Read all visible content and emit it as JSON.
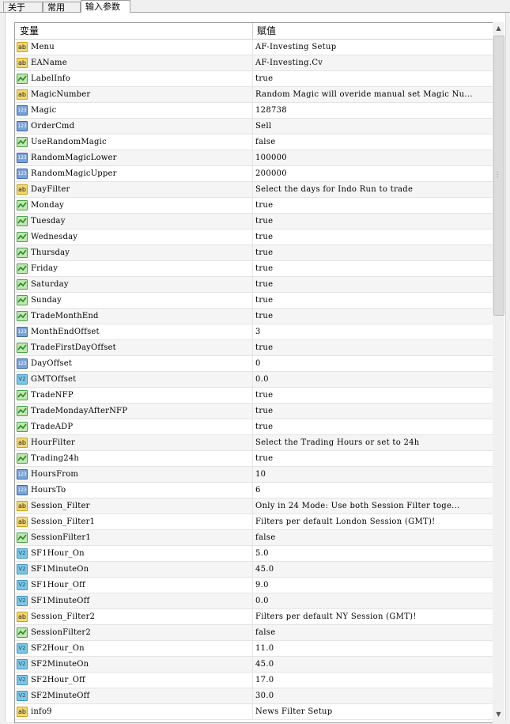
{
  "tabs": [
    "关于",
    "常用",
    "输入参数"
  ],
  "active_tab": 2,
  "grid": {
    "col_variable": "变量",
    "col_value": "赋值",
    "rows": [
      {
        "type": "ab",
        "name": "Menu",
        "value": " AF-Investing Setup"
      },
      {
        "type": "ab",
        "name": "EAName",
        "value": " AF-Investing.Cv"
      },
      {
        "type": "bool",
        "name": "LabelInfo",
        "value": "true"
      },
      {
        "type": "ab",
        "name": "MagicNumber",
        "value": " Random Magic will overide manual set Magic Nu..."
      },
      {
        "type": "123",
        "name": "Magic",
        "value": "128738"
      },
      {
        "type": "123",
        "name": "OrderCmd",
        "value": "Sell"
      },
      {
        "type": "bool",
        "name": "UseRandomMagic",
        "value": "false"
      },
      {
        "type": "123",
        "name": "RandomMagicLower",
        "value": "100000"
      },
      {
        "type": "123",
        "name": "RandomMagicUpper",
        "value": "200000"
      },
      {
        "type": "ab",
        "name": "DayFilter",
        "value": " Select the days for Indo Run to trade"
      },
      {
        "type": "bool",
        "name": "Monday",
        "value": "true"
      },
      {
        "type": "bool",
        "name": "Tuesday",
        "value": "true"
      },
      {
        "type": "bool",
        "name": "Wednesday",
        "value": "true"
      },
      {
        "type": "bool",
        "name": "Thursday",
        "value": "true"
      },
      {
        "type": "bool",
        "name": "Friday",
        "value": "true"
      },
      {
        "type": "bool",
        "name": "Saturday",
        "value": "true"
      },
      {
        "type": "bool",
        "name": "Sunday",
        "value": "true"
      },
      {
        "type": "bool",
        "name": "TradeMonthEnd",
        "value": "true"
      },
      {
        "type": "123",
        "name": "MonthEndOffset",
        "value": "3"
      },
      {
        "type": "bool",
        "name": "TradeFirstDayOffset",
        "value": "true"
      },
      {
        "type": "123",
        "name": "DayOffset",
        "value": "0"
      },
      {
        "type": "v2",
        "name": "GMTOffset",
        "value": "0.0"
      },
      {
        "type": "bool",
        "name": "TradeNFP",
        "value": "true"
      },
      {
        "type": "bool",
        "name": "TradeMondayAfterNFP",
        "value": "true"
      },
      {
        "type": "bool",
        "name": "TradeADP",
        "value": "true"
      },
      {
        "type": "ab",
        "name": "HourFilter",
        "value": " Select the Trading Hours or set to 24h"
      },
      {
        "type": "bool",
        "name": "Trading24h",
        "value": "true"
      },
      {
        "type": "123",
        "name": "HoursFrom",
        "value": "10"
      },
      {
        "type": "123",
        "name": "HoursTo",
        "value": "6"
      },
      {
        "type": "ab",
        "name": "Session_Filter",
        "value": " Only in 24 Mode: Use both Session Filter toge..."
      },
      {
        "type": "ab",
        "name": "Session_Filter1",
        "value": " Filters per default London Session (GMT)!"
      },
      {
        "type": "bool",
        "name": "SessionFilter1",
        "value": "false"
      },
      {
        "type": "v2",
        "name": "SF1Hour_On",
        "value": "5.0"
      },
      {
        "type": "v2",
        "name": "SF1MinuteOn",
        "value": "45.0"
      },
      {
        "type": "v2",
        "name": "SF1Hour_Off",
        "value": "9.0"
      },
      {
        "type": "v2",
        "name": "SF1MinuteOff",
        "value": "0.0"
      },
      {
        "type": "ab",
        "name": "Session_Filter2",
        "value": " Filters per default NY Session (GMT)!"
      },
      {
        "type": "bool",
        "name": "SessionFilter2",
        "value": "false"
      },
      {
        "type": "v2",
        "name": "SF2Hour_On",
        "value": "11.0"
      },
      {
        "type": "v2",
        "name": "SF2MinuteOn",
        "value": "45.0"
      },
      {
        "type": "v2",
        "name": "SF2Hour_Off",
        "value": "17.0"
      },
      {
        "type": "v2",
        "name": "SF2MinuteOff",
        "value": "30.0"
      },
      {
        "type": "ab",
        "name": "info9",
        "value": " News Filter Setup"
      }
    ]
  },
  "icons": {
    "ab": {
      "label": "ab",
      "bg": "#f3d870",
      "border": "#c9a21c"
    },
    "123": {
      "label": "123",
      "bg": "#7aa3d8",
      "border": "#3c6aa8"
    },
    "v2": {
      "label": "V2",
      "bg": "#7ec6e6",
      "border": "#3f95bd"
    },
    "bool": {
      "label": "",
      "bg": "#bfe7b0",
      "border": "#4aa24a"
    }
  }
}
